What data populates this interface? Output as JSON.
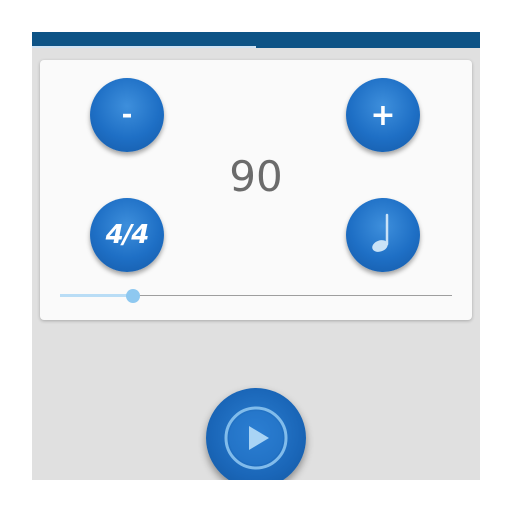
{
  "app": {
    "accent_color": "#1e6fc5",
    "header_color": "#0d5386"
  },
  "controls": {
    "decrease_label": "-",
    "increase_label": "+",
    "time_signature_label": "4/4",
    "note_value_icon": "quarter-note-icon"
  },
  "tempo": {
    "value": "90"
  },
  "tempo_slider": {
    "position_fraction": 0.185
  },
  "playback": {
    "play_icon": "play-icon"
  }
}
